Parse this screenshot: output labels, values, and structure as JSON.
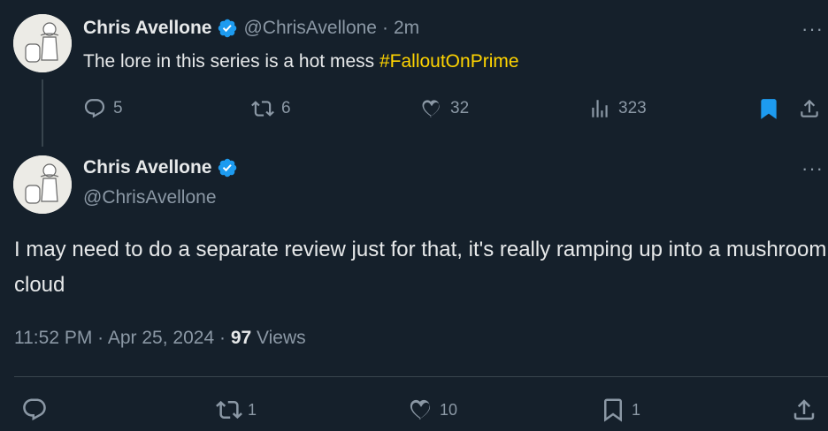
{
  "tweet1": {
    "display_name": "Chris Avellone",
    "handle": "@ChrisAvellone",
    "separator": "·",
    "time": "2m",
    "text_plain": "The lore in this series is a hot mess ",
    "hashtag": "#FalloutOnPrime",
    "replies": "5",
    "reposts": "6",
    "likes": "32",
    "views": "323",
    "more": "···"
  },
  "tweet2": {
    "display_name": "Chris Avellone",
    "handle": "@ChrisAvellone",
    "text": "I may need to do a separate review just for that, it's really ramping up into a mushroom cloud",
    "time": "11:52 PM",
    "date_separator": "·",
    "date": "Apr 25, 2024",
    "views_separator": "·",
    "views_count": "97",
    "views_label": "Views",
    "reposts": "1",
    "likes": "10",
    "bookmarks": "1",
    "more": "···"
  },
  "colors": {
    "background": "#15202b",
    "accent": "#1d9bf0",
    "hashtag": "#ffd400",
    "muted": "#8b98a5"
  },
  "icons": [
    "verified-badge-icon",
    "reply-icon",
    "repost-icon",
    "like-icon",
    "views-icon",
    "bookmark-icon",
    "share-icon",
    "more-icon"
  ]
}
